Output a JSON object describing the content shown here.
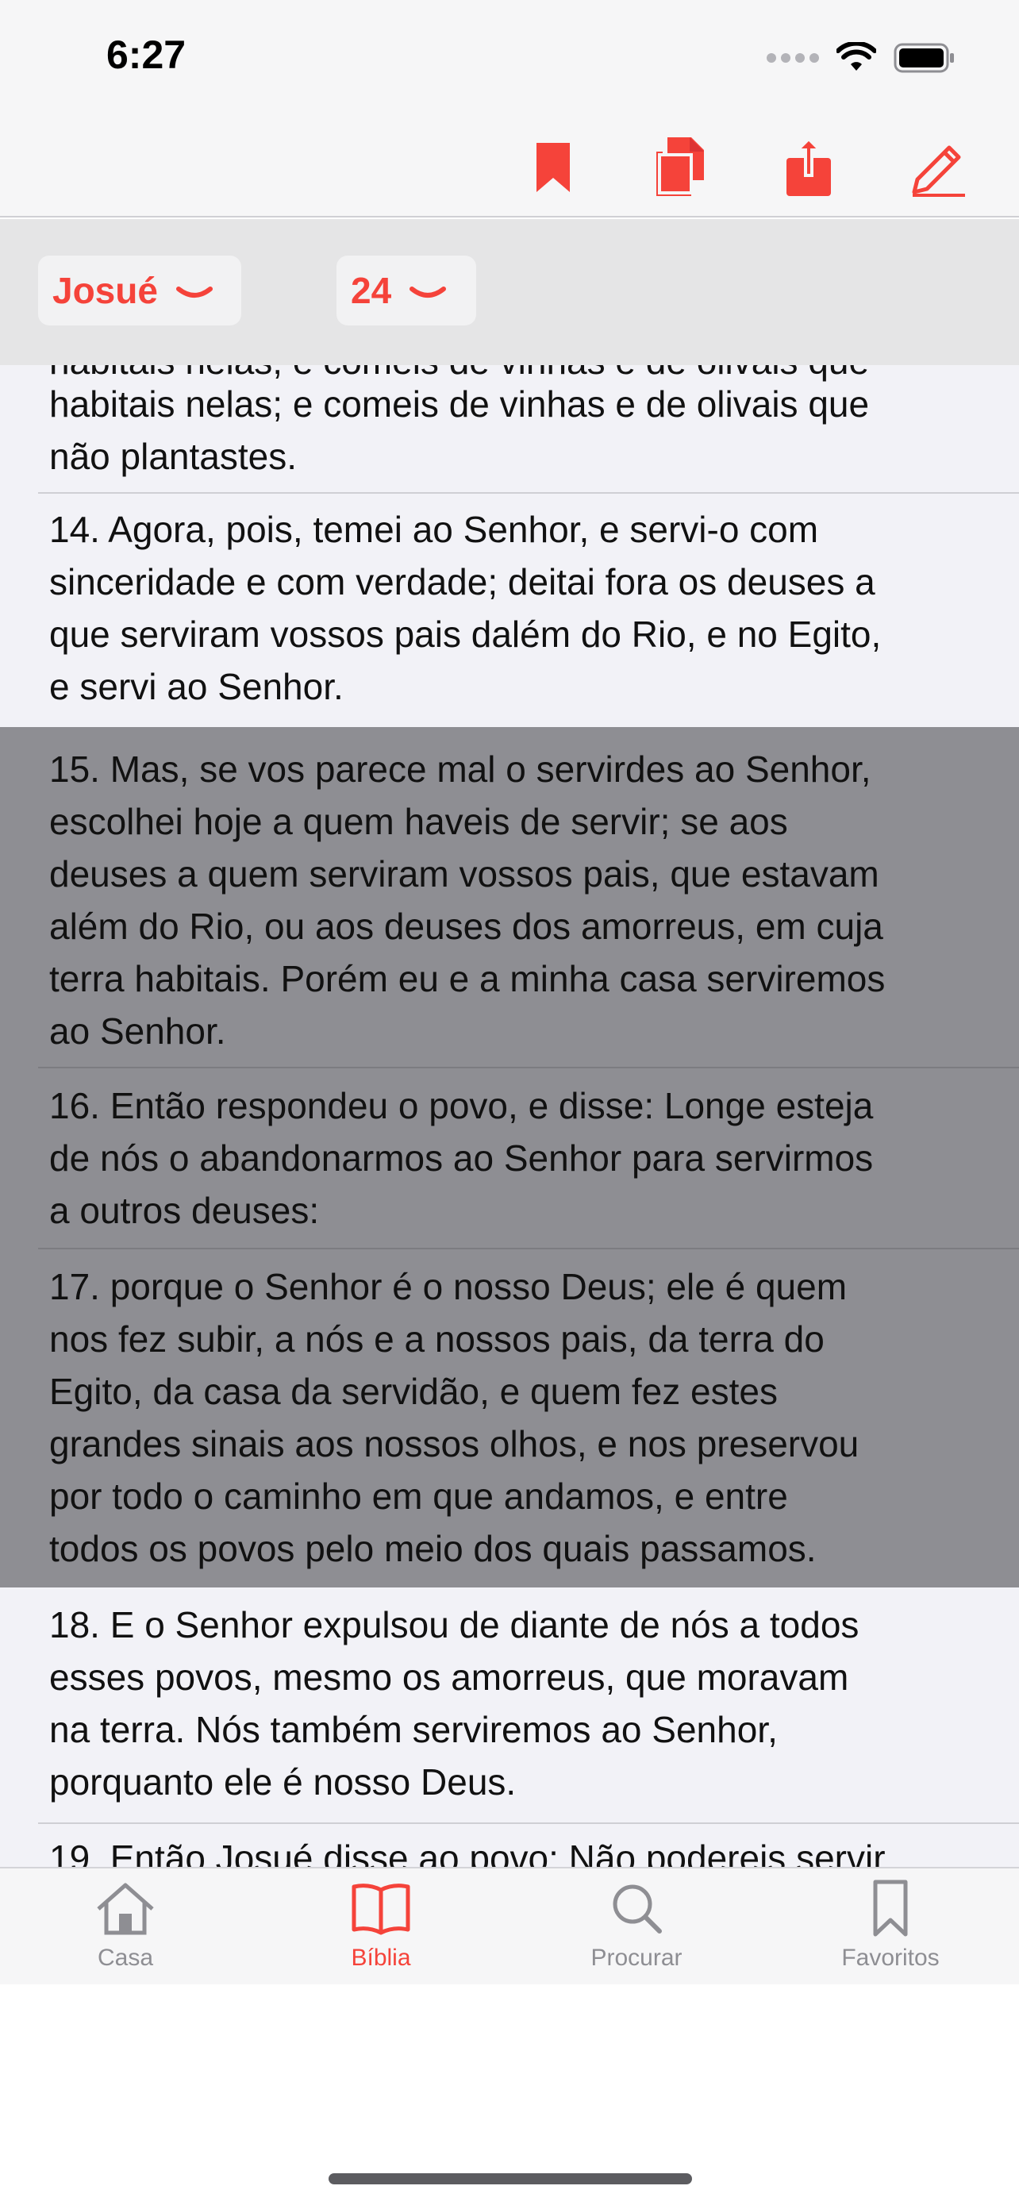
{
  "status": {
    "time": "6:27"
  },
  "toolbar": {
    "icons": [
      "bookmark-icon",
      "copy-icon",
      "share-icon",
      "edit-icon"
    ],
    "accent": "#f5433a"
  },
  "selectors": {
    "book": "Josué",
    "chapter": "24"
  },
  "verses": {
    "v13_tail": "habitais nelas; e comeis de vinhas e de olivais que\nnão plantastes.",
    "v14": "14. Agora, pois, temei ao Senhor, e servi-o com\nsinceridade e com verdade; deitai fora os deuses a\nque serviram vossos pais dalém do Rio, e no Egito,\ne servi ao Senhor.",
    "v15": "15. Mas, se vos parece mal o servirdes ao Senhor,\nescolhei hoje a quem haveis de servir; se aos\ndeuses a quem serviram vossos pais, que estavam\nalém do Rio, ou aos deuses dos amorreus, em cuja\nterra habitais. Porém eu e a minha casa serviremos\nao Senhor.",
    "v16": "16. Então respondeu o povo, e disse: Longe esteja\nde nós o abandonarmos ao Senhor para servirmos\na outros deuses:",
    "v17": "17. porque o Senhor é o nosso Deus; ele é quem\nnos fez subir, a nós e a nossos pais, da terra do\nEgito, da casa da servidão, e quem fez estes\ngrandes sinais aos nossos olhos, e nos preservou\npor todo o caminho em que andamos, e entre\ntodos os povos pelo meio dos quais passamos.",
    "v18": "18. E o Senhor expulsou de diante de nós a todos\nesses povos, mesmo os amorreus, que moravam\nna terra. Nós também serviremos ao Senhor,\nporquanto ele é nosso Deus.",
    "v19_head": "19. Então Josué disse ao povo: Não podereis servir",
    "selected_color": "#8e8e93"
  },
  "tabs": [
    {
      "label": "Casa",
      "icon": "house-icon",
      "active": false
    },
    {
      "label": "Bíblia",
      "icon": "book-icon",
      "active": true
    },
    {
      "label": "Procurar",
      "icon": "search-icon",
      "active": false
    },
    {
      "label": "Favoritos",
      "icon": "bookmark-icon",
      "active": false
    }
  ]
}
